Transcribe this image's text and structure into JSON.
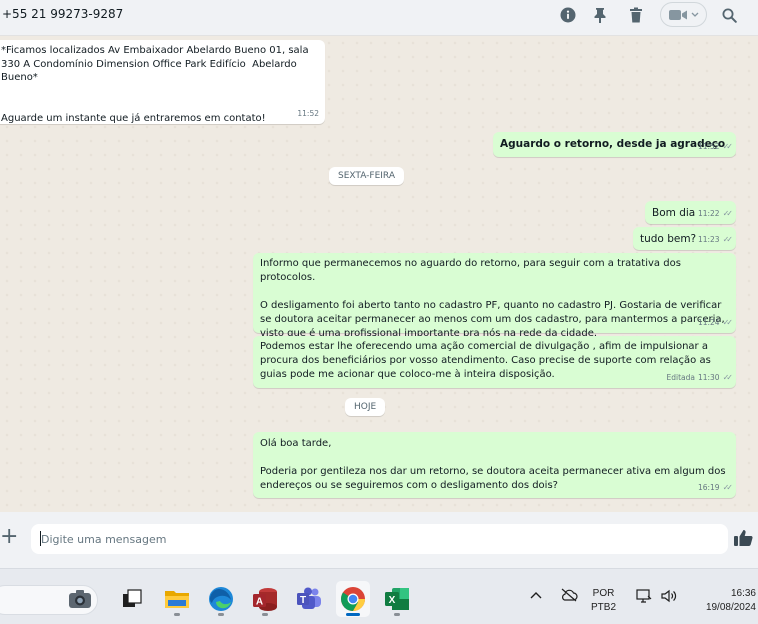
{
  "header": {
    "contact": "+55 21 99273-9287",
    "icons": [
      "info-icon",
      "pin-icon",
      "trash-icon",
      "video-call-icon",
      "search-icon"
    ]
  },
  "messages": [
    {
      "dir": "in",
      "text": "*Ficamos localizados Av Embaixador Abelardo Bueno 01, sala 330 A Condomínio Dimension Office Park Edifício  Abelardo Bueno*\n\n\nAguarde um instante que já entraremos em contato!",
      "time": "11:52"
    },
    {
      "dir": "out",
      "text": "Aguardo o retorno, desde ja agradeço",
      "time": "11:52"
    },
    {
      "dir": "out",
      "text": "Bom dia",
      "time": "11:22"
    },
    {
      "dir": "out",
      "text": "tudo bem?",
      "time": "11:23"
    },
    {
      "dir": "out",
      "text": "Informo que permanecemos no aguardo do retorno, para seguir com a tratativa dos protocolos.\n\nO desligamento foi aberto tanto no cadastro PF, quanto no cadastro PJ. Gostaria de verificar se doutora aceitar permanecer ao menos com um dos cadastro, para mantermos a parceria, visto que é uma profissional importante pra nós na rede da cidade.",
      "time": "11:24"
    },
    {
      "dir": "out",
      "text": "Podemos estar lhe oferecendo uma ação comercial de divulgação , afim de impulsionar a procura dos beneficiários por vosso atendimento. Caso precise de suporte com relação as guias pode me acionar que coloco-me à inteira disposição.",
      "time": "11:30",
      "edited": "Editada"
    },
    {
      "dir": "out",
      "text": "Olá boa tarde,\n\nPoderia por gentileza nos dar um retorno, se doutora aceita permanecer ativa em algum dos endereços ou se seguiremos com o desligamento dos dois?",
      "time": "16:19"
    }
  ],
  "date_chips": [
    "SEXTA-FEIRA",
    "HOJE"
  ],
  "compose": {
    "placeholder": "Digite uma mensagem"
  },
  "taskbar": {
    "apps": [
      "camera-app-icon",
      "task-view-icon",
      "file-explorer-icon",
      "edge-icon",
      "access-icon",
      "teams-icon",
      "chrome-icon",
      "excel-icon"
    ],
    "lang_top": "POR",
    "lang_bottom": "PTB2",
    "time": "16:36",
    "date": "19/08/2024"
  },
  "colors": {
    "outgoing": "#d9fdd3",
    "incoming": "#ffffff",
    "chat_bg": "#efeae2",
    "header_bg": "#f0f2f5"
  }
}
